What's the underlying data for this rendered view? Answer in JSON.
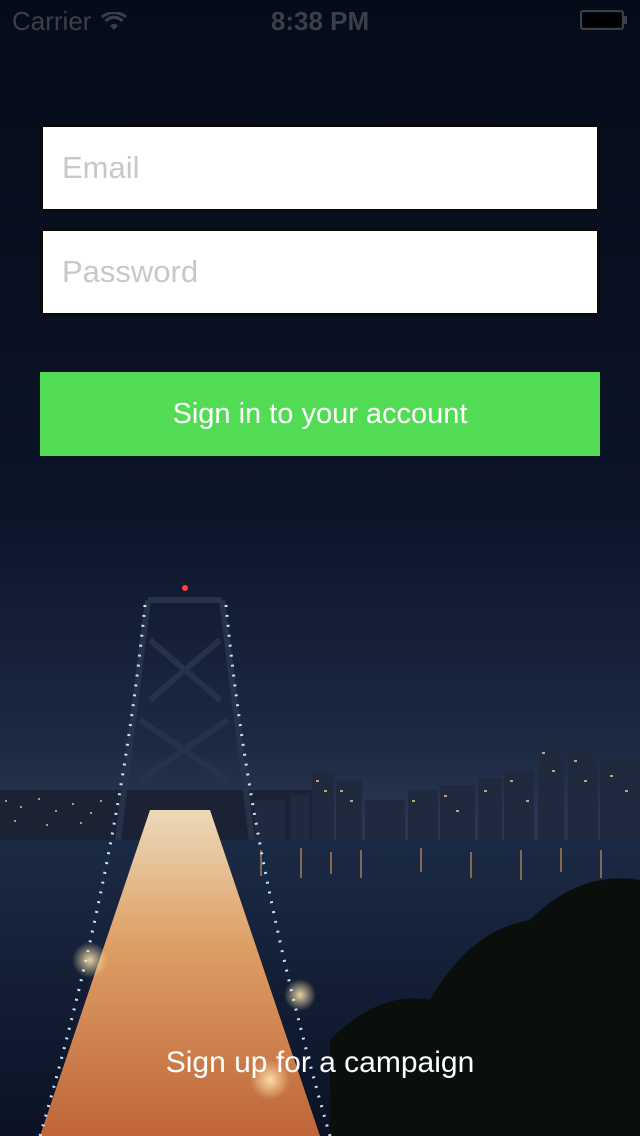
{
  "status_bar": {
    "carrier": "Carrier",
    "time": "8:38 PM",
    "wifi_icon": "wifi-icon",
    "battery_icon": "battery-icon"
  },
  "login": {
    "email_placeholder": "Email",
    "email_value": "",
    "password_placeholder": "Password",
    "password_value": "",
    "signin_label": "Sign in to your account"
  },
  "footer": {
    "signup_label": "Sign up for a campaign"
  },
  "colors": {
    "accent": "#52dc55",
    "background": "#070d1c"
  }
}
